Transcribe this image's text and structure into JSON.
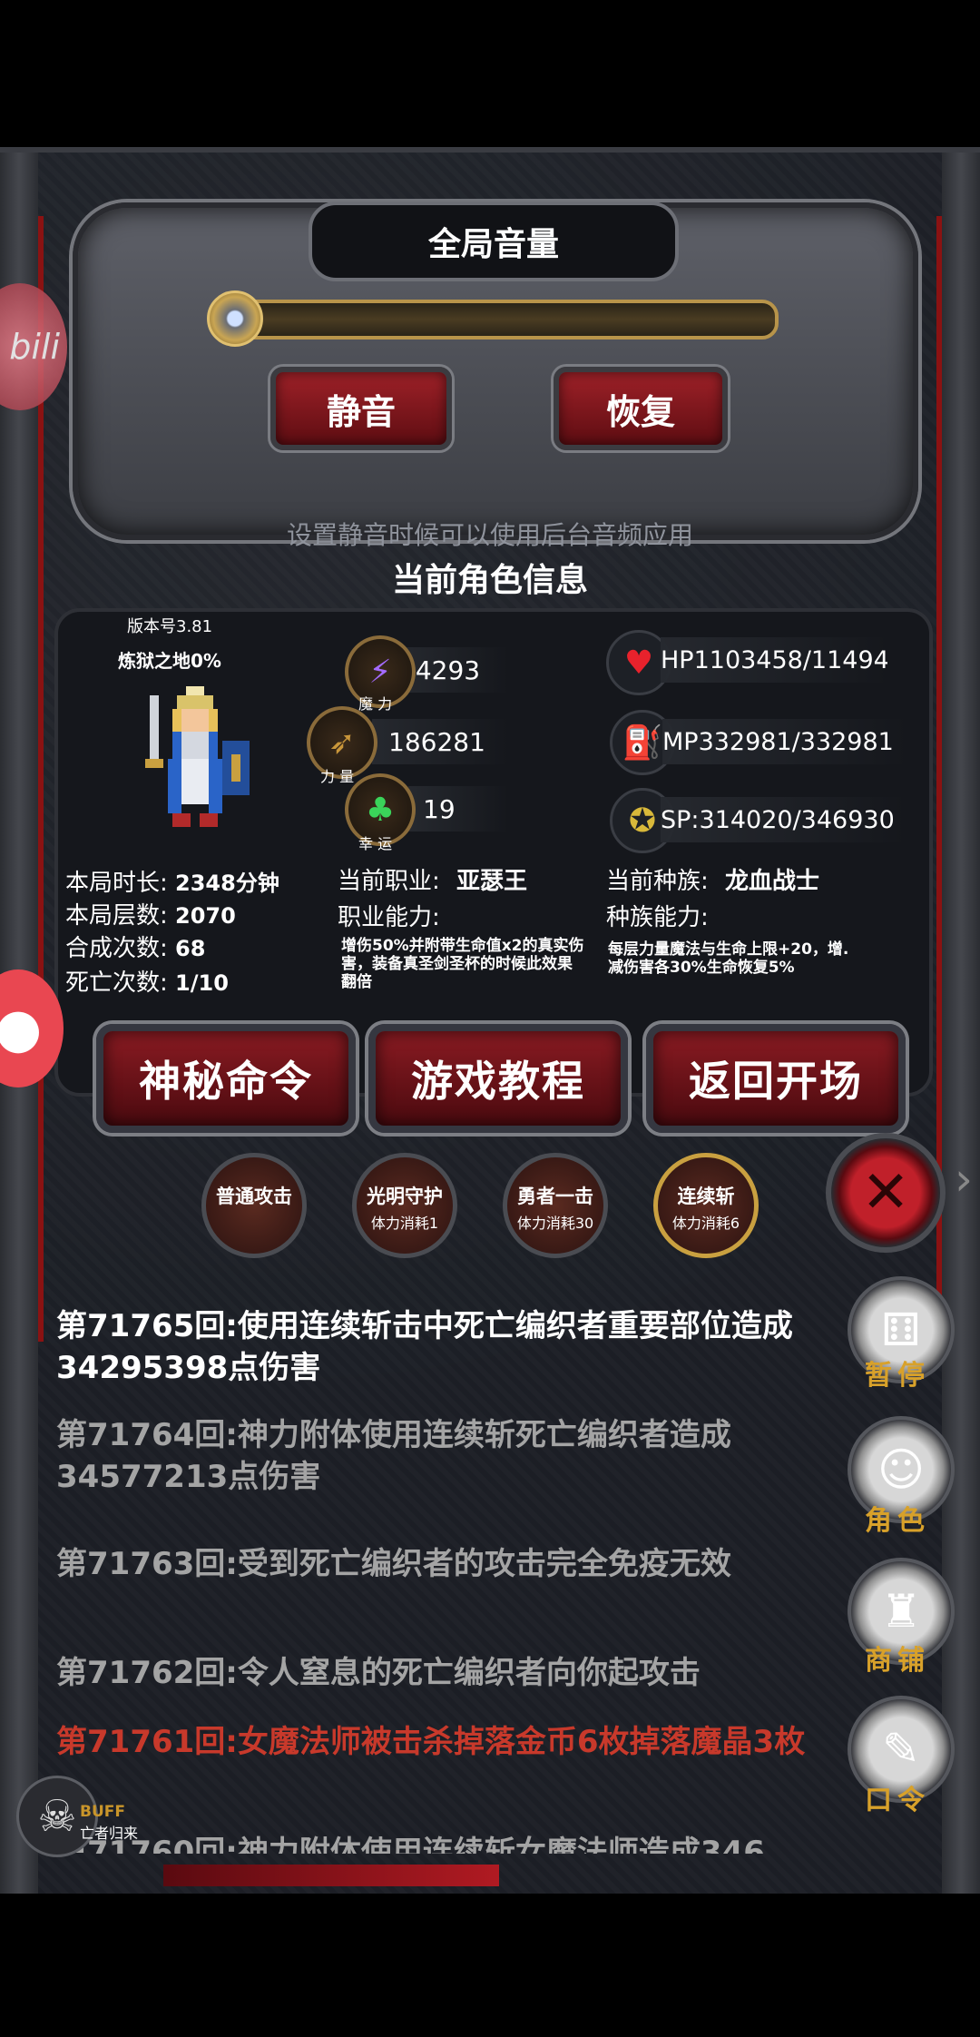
{
  "volume": {
    "title": "全局音量",
    "mute_label": "静音",
    "restore_label": "恢复",
    "hint": "设置静音时候可以使用后台音频应用"
  },
  "info": {
    "title": "当前角色信息",
    "version": "版本号3.81",
    "purgatory": "炼狱之地0%",
    "stats": {
      "magic_label": "魔 力",
      "magic_value": "84293",
      "power_label": "力 量",
      "power_value": "186281",
      "luck_label": "幸 运",
      "luck_value": "19",
      "hp": "HP1103458/11494",
      "mp": "MP332981/332981",
      "sp": "SP:314020/346930"
    },
    "session": [
      {
        "k": "本局时长:",
        "v": "2348分钟"
      },
      {
        "k": "本局层数:",
        "v": "2070"
      },
      {
        "k": "合成次数:",
        "v": "68"
      },
      {
        "k": "死亡次数:",
        "v": "1/10"
      }
    ],
    "job_label": "当前职业:",
    "job_value": "亚瑟王",
    "job_ability_label": "职业能力:",
    "job_ability_desc": "增伤50%并附带生命值x2的真实伤害，装备真圣剑圣杯的时候此效果翻倍",
    "race_label": "当前种族:",
    "race_value": "龙血战士",
    "race_ability_label": "种族能力:",
    "race_ability_desc": "每层力量魔法与生命上限+20，增.减伤害各30%生命恢复5%",
    "buttons": {
      "secret": "神秘命令",
      "tutorial": "游戏教程",
      "back": "返回开场"
    }
  },
  "skills": [
    {
      "name": "普通攻击",
      "cost": ""
    },
    {
      "name": "光明守护",
      "cost": "体力消耗1"
    },
    {
      "name": "勇者一击",
      "cost": "体力消耗30"
    },
    {
      "name": "连续斩",
      "cost": "体力消耗6"
    }
  ],
  "log": [
    {
      "text": "第71765回:使用连续斩击中死亡编织者重要部位造成34295398点伤害",
      "color": "#ffffff"
    },
    {
      "text": "第71764回:神力附体使用连续斩死亡编织者造成34577213点伤害",
      "color": "#a4a4a4"
    },
    {
      "text": "第71763回:受到死亡编织者的攻击完全免疫无效",
      "color": "#a4a4a4"
    },
    {
      "text": "第71762回:令人窒息的死亡编织者向你起攻击",
      "color": "#a4a4a4"
    },
    {
      "text": "第71761回:女魔法师被击杀掉落金币6枚掉落魔晶3枚",
      "color": "#c8392b"
    },
    {
      "text": "第71760回:神力附体使用连续斩女魔法师造成346",
      "color": "#a4a4a4"
    }
  ],
  "side_buttons": {
    "pause": "暂停",
    "role": "角色",
    "shop": "商铺",
    "command": "口令"
  },
  "buff": {
    "label": "BUFF",
    "sub": "亡者归来"
  },
  "overlay": {
    "bili": "bili"
  }
}
